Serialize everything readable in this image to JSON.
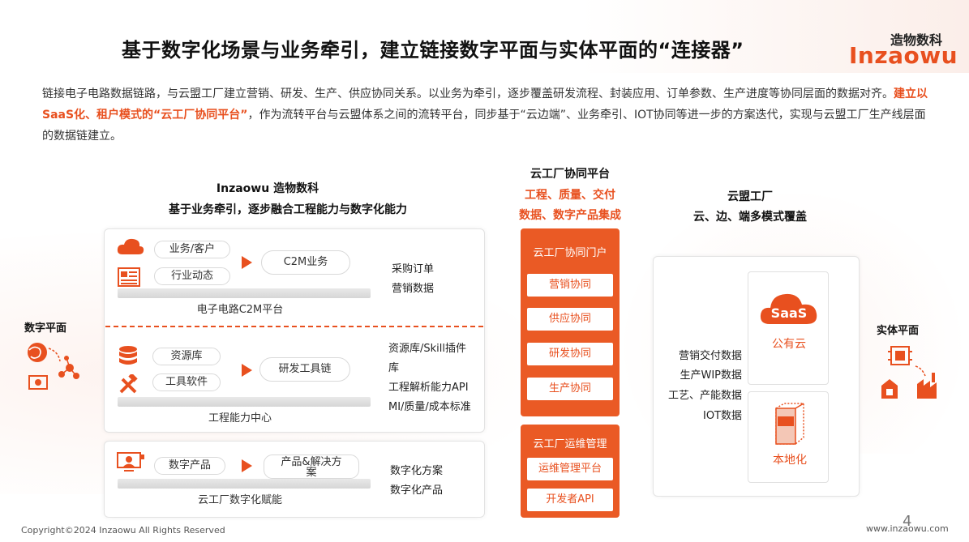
{
  "header": {
    "title": "基于数字化场景与业务牵引，建立链接数字平面与实体平面的“连接器”",
    "logo_cn": "造物数科",
    "logo_en": "Inzaowu"
  },
  "intro": {
    "part1": "链接电子电路数据链路，与云盟工厂建立营销、研发、生产、供应协同关系。以业务为牵引，逐步覆盖研发流程、封装应用、订单参数、生产进度等协同层面的数据对齐。",
    "highlight": "建立以SaaS化、租户模式的“云工厂协同平台”",
    "part2": "，作为流转平台与云盟体系之间的流转平台，同步基于“云边端”、业务牵引、IOT协同等进一步的方案迭代，实现与云盟工厂生产线层面的数据链建立。"
  },
  "left_column": {
    "heading1": "Inzaowu 造物数科",
    "heading2": "基于业务牵引，逐步融合工程能力与数字化能力",
    "section_c2m": {
      "pills": [
        "业务/客户",
        "行业动态"
      ],
      "target": "C2M业务",
      "platform": "电子电路C2M平台",
      "side": [
        "采购订单",
        "营销数据"
      ]
    },
    "section_eng": {
      "pills": [
        "资源库",
        "工具软件"
      ],
      "target": "研发工具链",
      "platform": "工程能力中心",
      "side": [
        "资源库/Skill插件",
        "库",
        "工程解析能力API",
        "MI/质量/成本标准"
      ]
    },
    "section_digital": {
      "pills": [
        "数字产品"
      ],
      "target": "产品&解决方案",
      "platform": "云工厂数字化赋能",
      "side": [
        "数字化方案",
        "数字化产品"
      ]
    }
  },
  "middle_column": {
    "heading1": "云工厂协同平台",
    "heading2": "工程、质量、交付",
    "heading3": "数据、数字产品集成",
    "portal": {
      "title": "云工厂协同门户",
      "buttons": [
        "营销协同",
        "供应协同",
        "研发协同",
        "生产协同"
      ]
    },
    "ops": {
      "title": "云工厂运维管理",
      "buttons": [
        "运维管理平台",
        "开发者API"
      ]
    }
  },
  "right_column": {
    "heading1": "云盟工厂",
    "heading2": "云、边、端多模式覆盖",
    "data_items": [
      "营销交付数据",
      "生产WIP数据",
      "工艺、产能数据",
      "IOT数据"
    ],
    "cloud_label": "SaaS",
    "public_cloud": "公有云",
    "local_label": "本地化"
  },
  "ends": {
    "left": "数字平面",
    "right": "实体平面"
  },
  "footer": {
    "copyright": "Copyright©2024  Inzaowu  All Rights Reserved",
    "page": "4",
    "site": "www.inzaowu.com"
  },
  "colors": {
    "accent": "#e8501f",
    "panel_border": "#e3e3e3"
  }
}
